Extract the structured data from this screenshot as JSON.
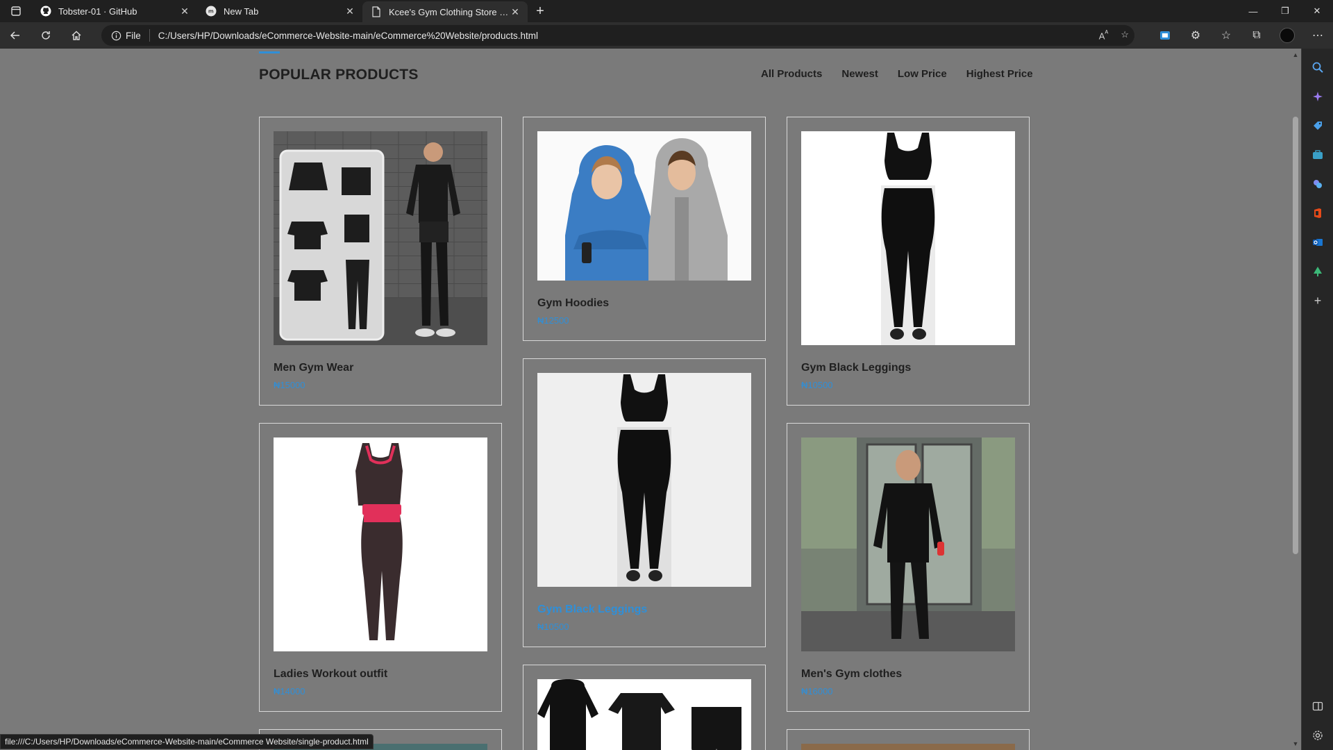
{
  "browser": {
    "tabs": [
      {
        "title": "Tobster-01 · GitHub",
        "icon": "github-icon",
        "active": false
      },
      {
        "title": "New Tab",
        "icon": "edge-newtab-icon",
        "active": false
      },
      {
        "title": "Kcee's Gym Clothing Store - PRO",
        "icon": "page-icon",
        "active": true
      }
    ],
    "address": {
      "scheme_label": "File",
      "url": "C:/Users/HP/Downloads/eCommerce-Website-main/eCommerce%20Website/products.html"
    },
    "status_url": "file:///C:/Users/HP/Downloads/eCommerce-Website-main/eCommerce Website/single-product.html"
  },
  "page": {
    "heading": "POPULAR PRODUCTS",
    "filters": [
      "All Products",
      "Newest",
      "Low Price",
      "Highest Price"
    ],
    "products": [
      {
        "name": "Men Gym Wear",
        "price": "₦15000"
      },
      {
        "name": "Gym Hoodies",
        "price": "₦12500"
      },
      {
        "name": "Gym Black Leggings",
        "price": "₦10500"
      },
      {
        "name": "Ladies Workout outfit",
        "price": "₦14000"
      },
      {
        "name": "Gym Black Leggings",
        "price": "₦10500"
      },
      {
        "name": "Men's Gym clothes",
        "price": "₦16000"
      }
    ]
  },
  "colors": {
    "page_bg": "#7a7a7a",
    "accent": "#2f8fd8",
    "chrome_bg": "#202020"
  }
}
